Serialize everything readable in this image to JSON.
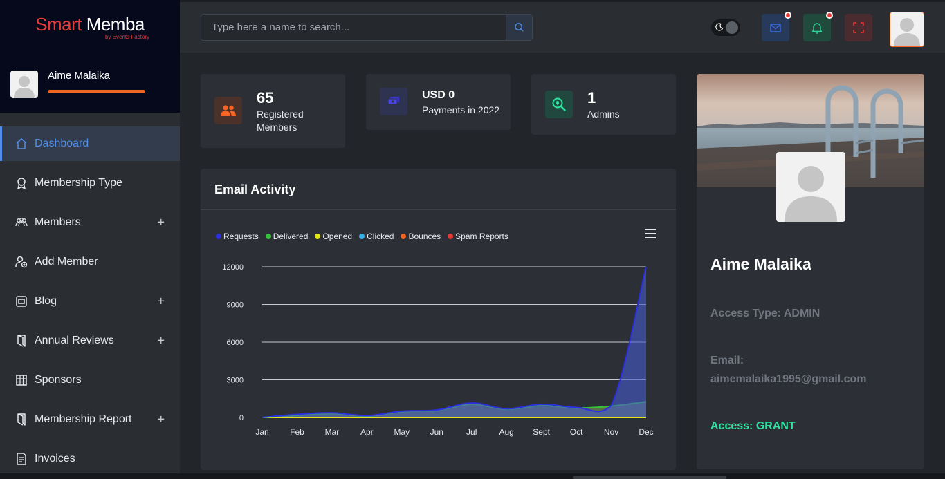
{
  "brand": {
    "name_part1": "Smart",
    "name_part2": "Memba",
    "tagline": "by Events Factory"
  },
  "user": {
    "name": "Aime Malaika"
  },
  "sidebar": {
    "items": [
      {
        "label": "Dashboard",
        "icon": "home-icon",
        "active": true,
        "expandable": false
      },
      {
        "label": "Membership Type",
        "icon": "award-icon",
        "active": false,
        "expandable": false
      },
      {
        "label": "Members",
        "icon": "users-icon",
        "active": false,
        "expandable": true
      },
      {
        "label": "Add Member",
        "icon": "user-add-icon",
        "active": false,
        "expandable": false
      },
      {
        "label": "Blog",
        "icon": "blog-icon",
        "active": false,
        "expandable": true
      },
      {
        "label": "Annual Reviews",
        "icon": "document-icon",
        "active": false,
        "expandable": true
      },
      {
        "label": "Sponsors",
        "icon": "grid-icon",
        "active": false,
        "expandable": false
      },
      {
        "label": "Membership Report",
        "icon": "report-icon",
        "active": false,
        "expandable": true
      },
      {
        "label": "Invoices",
        "icon": "invoice-icon",
        "active": false,
        "expandable": false
      }
    ],
    "plus_symbol": "+"
  },
  "header": {
    "search_placeholder": "Type here a name to search...",
    "notifications": {
      "mail_has_dot": true,
      "bell_has_dot": true
    }
  },
  "stats": {
    "members": {
      "value": "65",
      "label": "Registered Members"
    },
    "payments": {
      "currency": "USD",
      "value": "0",
      "label": "Payments in 2022"
    },
    "admins": {
      "value": "1",
      "label": "Admins"
    }
  },
  "chart_section": {
    "title": "Email Activity"
  },
  "chart_data": {
    "type": "area",
    "categories": [
      "Jan",
      "Feb",
      "Mar",
      "Apr",
      "May",
      "Jun",
      "Jul",
      "Aug",
      "Sept",
      "Oct",
      "Nov",
      "Dec"
    ],
    "ylim": [
      0,
      12000
    ],
    "yticks": [
      "0",
      "3000",
      "6000",
      "9000",
      "12000"
    ],
    "legend_position": "top-left",
    "series": [
      {
        "name": "Requests",
        "color": "#2d2ee0",
        "values": [
          0,
          250,
          380,
          150,
          500,
          600,
          1150,
          700,
          1050,
          800,
          950,
          12000
        ]
      },
      {
        "name": "Delivered",
        "color": "#37c43a",
        "values": [
          0,
          150,
          300,
          100,
          450,
          550,
          1050,
          650,
          950,
          750,
          900,
          1250
        ]
      },
      {
        "name": "Opened",
        "color": "#e5e514",
        "values": [
          0,
          0,
          0,
          0,
          0,
          0,
          0,
          0,
          0,
          0,
          0,
          0
        ]
      },
      {
        "name": "Clicked",
        "color": "#3ab0e8",
        "values": [
          0,
          0,
          0,
          0,
          0,
          0,
          0,
          0,
          0,
          0,
          0,
          0
        ]
      },
      {
        "name": "Bounces",
        "color": "#f26522",
        "values": [
          0,
          0,
          0,
          0,
          0,
          0,
          0,
          0,
          0,
          0,
          0,
          0
        ]
      },
      {
        "name": "Spam Reports",
        "color": "#e53935",
        "values": [
          0,
          0,
          0,
          0,
          0,
          0,
          0,
          0,
          0,
          0,
          0,
          0
        ]
      }
    ]
  },
  "profile": {
    "name": "Aime Malaika",
    "access_type": "Access Type: ADMIN",
    "email_label": "Email:",
    "email": "aimemalaika1995@gmail.com",
    "access": "Access: GRANT"
  },
  "colors": {
    "accent": "#4f8de8",
    "brand_red": "#e33a3a",
    "orange": "#f26522",
    "grant": "#2ee3a0"
  }
}
